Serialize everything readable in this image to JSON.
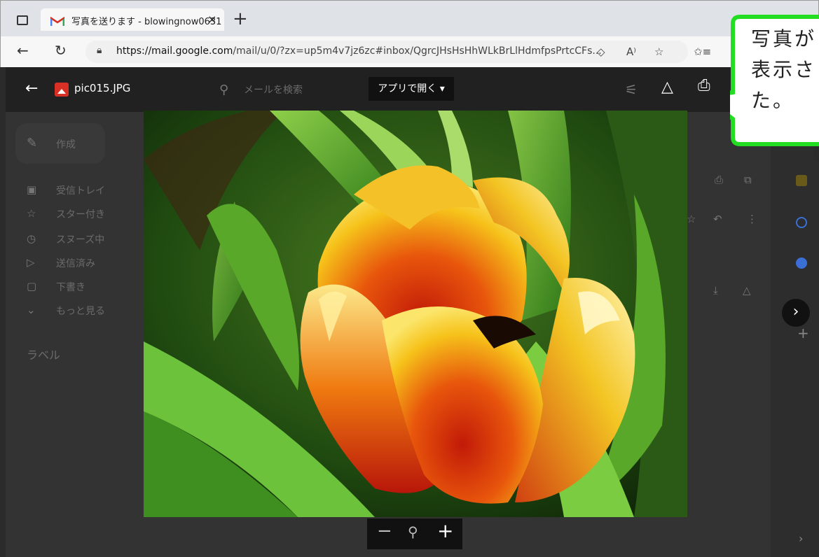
{
  "browser": {
    "tab_title": "写真を送ります - blowingnow0631",
    "tab_close": "×",
    "new_tab": "+",
    "url_domain": "https://mail.google.com",
    "url_path": "/mail/u/0/?zx=up5m4v7jz6zc#inbox/QgrcJHsHsHhWLkBrLlHdmfpsPrtcCFs...",
    "icons": [
      "tab-strip-icon",
      "back-icon",
      "refresh-icon",
      "lock-icon",
      "reader-icon",
      "read-aloud-icon",
      "favorites-add-icon",
      "favorites-icon"
    ]
  },
  "viewer": {
    "back": "←",
    "file_name": "pic015.JPG",
    "open_with": "アプリで開く ▾",
    "zoom_out": "−",
    "zoom_in": "+",
    "next": "›"
  },
  "gmail_background": {
    "search_placeholder": "メールを検索",
    "compose": "作成",
    "sidebar": [
      {
        "icon": "▣",
        "label": "受信トレイ"
      },
      {
        "icon": "☆",
        "label": "スター付き"
      },
      {
        "icon": "◷",
        "label": "スヌーズ中"
      },
      {
        "icon": "▷",
        "label": "送信済み"
      },
      {
        "icon": "▢",
        "label": "下書き"
      },
      {
        "icon": "⌄",
        "label": "もっと見る"
      }
    ],
    "labels_heading": "ラベル"
  },
  "callout": {
    "text": "写真が表示さた。"
  },
  "colors": {
    "callout_border": "#22dd22",
    "callout_fill": "#ffffff",
    "viewer_bg": "#2d2d2d"
  }
}
